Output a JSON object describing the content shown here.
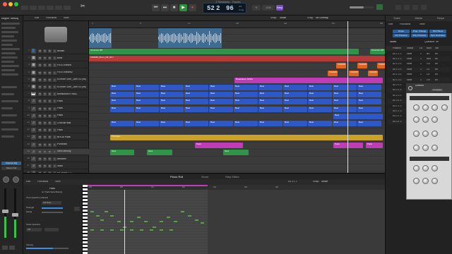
{
  "window": {
    "title": "2 Sessions - Tracks",
    "close": "#ff5f57",
    "minimize": "#febc2e",
    "zoom": "#28c840"
  },
  "transport": {
    "rewind": "⏮",
    "forward": "⏭",
    "stop": "■",
    "play": "▶",
    "record": "●",
    "cycle": "⟲",
    "bars": "52",
    "beats": "2",
    "tempo": "96",
    "key": "Cmaj",
    "time_sig": "4/4",
    "count_in": "1234",
    "mode_label": "Keep"
  },
  "colors": {
    "accent": "#3a8ee6",
    "blue_region": "#2e57c7",
    "green_region": "#2f9447",
    "orange_region": "#e0641f",
    "pink_region": "#c03bb6",
    "yellow_region": "#c9a227",
    "red_region": "#b83a36",
    "audio_region": "#3f6c93"
  },
  "tracks_toolbar": {
    "edit": "Edit",
    "functions": "Functions",
    "view": "View",
    "snap_label": "Snap:",
    "snap_value": "Smart",
    "drag_label": "Drag:",
    "drag_value": "No Overlap"
  },
  "inspector": {
    "region_label": "Region: Melody",
    "track_label": "Channel EQ",
    "output": "Stereo Out"
  },
  "ruler": {
    "bars": [
      "1",
      "9",
      "17",
      "25",
      "33",
      "41",
      "49",
      "57"
    ]
  },
  "tracks": [
    {
      "num": "1",
      "icon": "👤",
      "name": "Breath"
    },
    {
      "num": "2",
      "icon": "▦",
      "name": "Beat"
    },
    {
      "num": "3",
      "icon": "▦",
      "name": "Fill & Erased"
    },
    {
      "num": "4",
      "icon": "▦",
      "name": "Fill & Erased2"
    },
    {
      "num": "5",
      "icon": "▦",
      "name": "KSHMR Drm_Jam 03 (96)"
    },
    {
      "num": "6",
      "icon": "▦",
      "name": "KSHMR Drm_Jam 03 (96)"
    },
    {
      "num": "7",
      "icon": "🎹",
      "name": "Breakdown FINAL"
    },
    {
      "num": "8",
      "icon": "♫",
      "name": "Pads"
    },
    {
      "num": "9",
      "icon": "♫",
      "name": "Pads"
    },
    {
      "num": "10",
      "icon": "♫",
      "name": "Pads"
    },
    {
      "num": "11",
      "icon": "♫",
      "name": "ChorusPads"
    },
    {
      "num": "12",
      "icon": "♫",
      "name": "Pads"
    },
    {
      "num": "13",
      "icon": "♫",
      "name": "BRIJA Pads"
    },
    {
      "num": "14",
      "icon": "♫",
      "name": "Pizzicato"
    },
    {
      "num": "15",
      "icon": "♫",
      "name": "Sera Melody"
    },
    {
      "num": "16",
      "icon": "♫",
      "name": "windbell"
    },
    {
      "num": "17",
      "icon": "♫",
      "name": "violin"
    },
    {
      "num": "18",
      "icon": "♫",
      "name": "NY Brass T3"
    }
  ],
  "regions": {
    "structure": "Structure 8/8",
    "structure2": "Structure 8/8",
    "kshmr": "KSHMR_Drum_Fill_04.1",
    "kshmr2": "KSHMR Orchest",
    "breakdown": "Breakdown FINAL",
    "beat": "Beat",
    "pizz": "Pizzicato",
    "pads": "Pads",
    "sera": "Sera"
  },
  "right_panel": {
    "tabs": [
      "Event",
      "Marker",
      "Tempo"
    ],
    "edit": "Edit",
    "functions": "Functions",
    "view": "View",
    "buttons": [
      "Notes",
      "Prog. Change",
      "Pitch Bend",
      "Ctrl Pressure",
      "Poly Pressure",
      "Syst. Exclusive"
    ],
    "list_header": {
      "label": "Notes",
      "quantize": "Quantize: off"
    },
    "columns": [
      "Position",
      "Status",
      "Ch",
      "Num",
      "Val"
    ],
    "events": [
      {
        "pos": "52 1 1 1",
        "status": "Note",
        "ch": "1",
        "num": "B4",
        "val": "80"
      },
      {
        "pos": "52 1 1 1",
        "status": "Note",
        "ch": "1",
        "num": "A#4",
        "val": "80"
      },
      {
        "pos": "52 1 2 1",
        "status": "Note",
        "ch": "1",
        "num": "G4",
        "val": "80"
      },
      {
        "pos": "52 1 3 1",
        "status": "Note",
        "ch": "1",
        "num": "C5",
        "val": "80"
      },
      {
        "pos": "52 1 3 1",
        "status": "Note",
        "ch": "1",
        "num": "C4",
        "val": "80"
      },
      {
        "pos": "52 1 3 1",
        "status": "Note",
        "ch": "1",
        "num": "G5",
        "val": "80"
      },
      {
        "pos": "52 2 1 1",
        "status": "Note",
        "ch": "1",
        "num": "F4",
        "val": "80"
      },
      {
        "pos": "52 2 1 1",
        "status": "Note",
        "ch": "1",
        "num": "A4",
        "val": "80"
      },
      {
        "pos": "52 2 2 1",
        "status": "Note",
        "ch": "1",
        "num": "D5",
        "val": "80"
      },
      {
        "pos": "52 3 1 1",
        "status": "Note",
        "ch": "1",
        "num": "E4",
        "val": "80"
      },
      {
        "pos": "53 1 1 1",
        "status": "Note",
        "ch": "1",
        "num": "F4",
        "val": "80"
      },
      {
        "pos": "53 1 1 1",
        "status": "Note",
        "ch": "1",
        "num": "A4",
        "val": "80"
      },
      {
        "pos": "53 2 1 1",
        "status": "Note",
        "ch": "1",
        "num": "D5",
        "val": "80"
      },
      {
        "pos": "53 3 1 1",
        "status": "Note",
        "ch": "1",
        "num": "E4",
        "val": "80"
      }
    ]
  },
  "plugin": {
    "title": "Untitled",
    "preset": "Compare"
  },
  "editor": {
    "tabs": [
      "Piano Roll",
      "Score",
      "Step Editor"
    ],
    "toolbar_edit": "Edit",
    "toolbar_functions": "Functions",
    "toolbar_view": "View",
    "snap_label": "Snap:",
    "snap_value": "Smart",
    "region_name": "Pads",
    "region_sub": "on Track Sera Melody",
    "time_quantize": "Time Quantize (classic)",
    "quantize_value": "1/8 Note",
    "strength": "Strength",
    "swing": "Swing",
    "scale_quantize": "Scale Quantize",
    "scale_value": "Off",
    "velocity": "Velocity",
    "ruler": [
      "49",
      "50",
      "51",
      "52",
      "53",
      "54",
      "55"
    ],
    "playhead_pos": "53 3 1 1"
  }
}
